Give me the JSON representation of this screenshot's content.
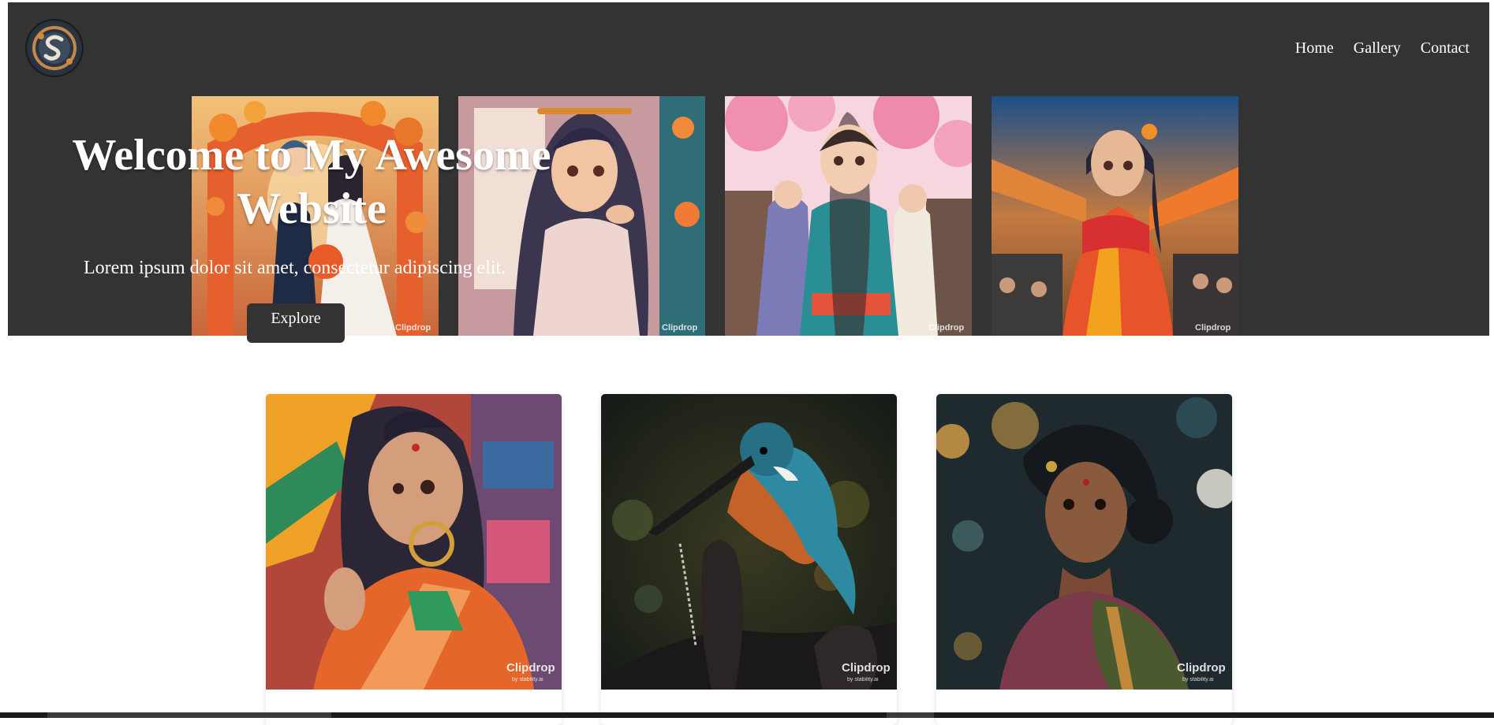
{
  "header": {
    "logo_icon": "spiral-s-logo-icon",
    "nav": [
      {
        "label": "Home"
      },
      {
        "label": "Gallery"
      },
      {
        "label": "Contact"
      }
    ]
  },
  "hero": {
    "title": "Welcome to My Awesome Website",
    "subtitle": "Lorem ipsum dolor sit amet, consectetur adipiscing elit.",
    "button_label": "Explore",
    "background_color": "#333333",
    "strip_images": [
      {
        "subject": "anime couple wedding under floral arch",
        "watermark": "Clipdrop"
      },
      {
        "subject": "anime girl in pink kurta",
        "watermark": "Clipdrop"
      },
      {
        "subject": "anime girl in kimono under cherry blossoms",
        "watermark": "Clipdrop"
      },
      {
        "subject": "anime girl in saree at street market",
        "watermark": "Clipdrop"
      }
    ]
  },
  "gallery": {
    "cards": [
      {
        "subject": "anime girl in orange saree",
        "watermark": "Clipdrop",
        "watermark_sub": "by stability.ai"
      },
      {
        "subject": "kingfisher on branch",
        "watermark": "Clipdrop",
        "watermark_sub": "by stability.ai"
      },
      {
        "subject": "woman in green saree at night",
        "watermark": "Clipdrop",
        "watermark_sub": "by stability.ai"
      }
    ]
  }
}
